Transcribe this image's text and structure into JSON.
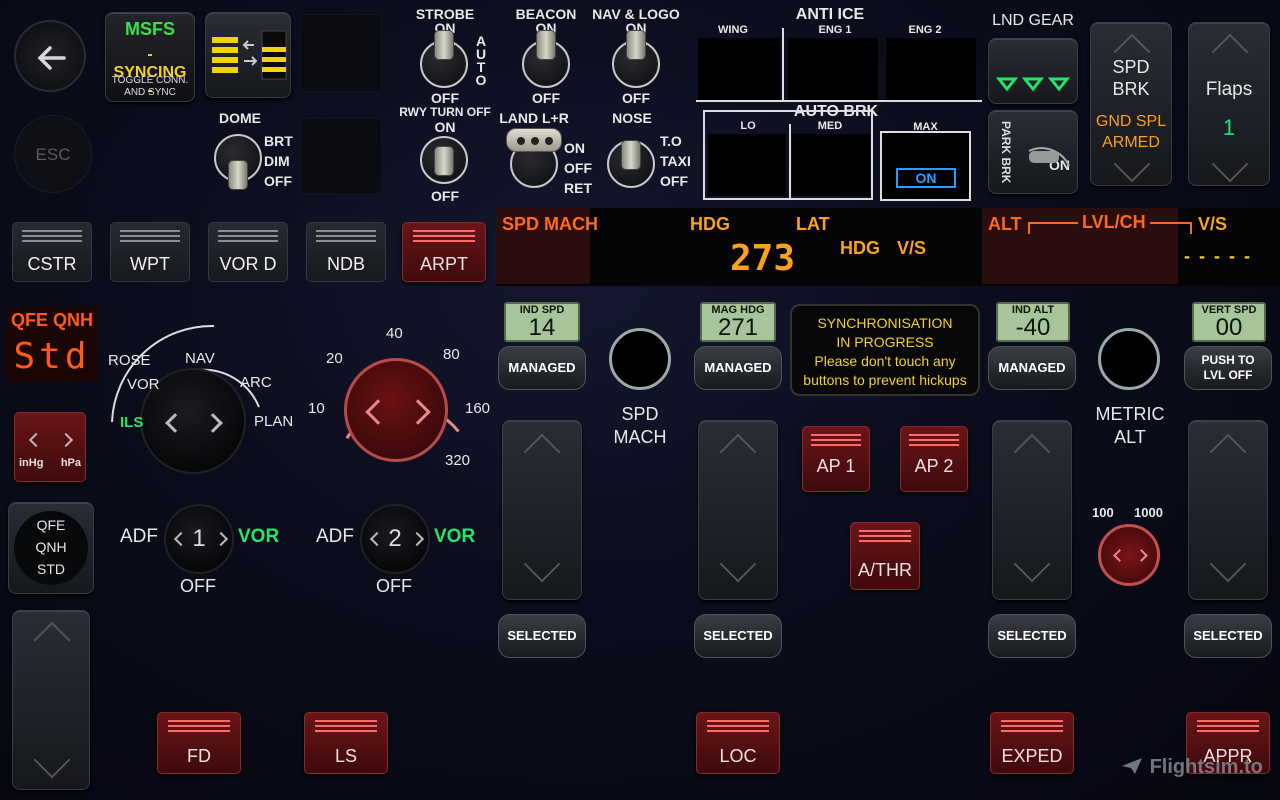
{
  "left": {
    "back_icon": "arrow-left-icon",
    "esc": "ESC",
    "msfs_title": "MSFS",
    "msfs_status": "- SYNCING -",
    "msfs_sub1": "TOGGLE CONN.",
    "msfs_sub2": "AND SYNC",
    "dome_title": "DOME",
    "dome_positions": [
      "BRT",
      "DIM",
      "OFF"
    ]
  },
  "lights": {
    "strobe": {
      "title": "STROBE",
      "top": "ON",
      "bottom": "OFF",
      "side": "AUTO"
    },
    "beacon": {
      "title": "BEACON",
      "top": "ON",
      "bottom": "OFF"
    },
    "navlogo": {
      "title": "NAV & LOGO",
      "top": "ON",
      "bottom": "OFF"
    },
    "rwy": {
      "title": "RWY TURN OFF",
      "top": "ON",
      "bottom": "OFF"
    },
    "land": {
      "title": "LAND L+R",
      "pos": [
        "ON",
        "OFF",
        "RET"
      ]
    },
    "nose": {
      "title": "NOSE",
      "pos": [
        "T.O",
        "TAXI",
        "OFF"
      ]
    }
  },
  "anti_ice": {
    "title": "ANTI ICE",
    "cols": [
      "WING",
      "ENG 1",
      "ENG 2"
    ]
  },
  "auto_brk": {
    "title": "AUTO BRK",
    "cols": [
      "LO",
      "MED",
      "MAX"
    ],
    "max_state": "ON"
  },
  "gear": {
    "title": "LND GEAR",
    "park_brk": "PARK BRK",
    "park_state": "ON"
  },
  "spd_brk": {
    "title1": "SPD",
    "title2": "BRK",
    "state1": "GND SPL",
    "state2": "ARMED"
  },
  "flaps": {
    "title": "Flaps",
    "value": "1"
  },
  "efis": {
    "keys": [
      "CSTR",
      "WPT",
      "VOR D",
      "NDB",
      "ARPT"
    ]
  },
  "fma": {
    "spd_mach": "SPD MACH",
    "hdg": "HDG",
    "lat": "LAT",
    "hdg_val": "273",
    "hdg2": "HDG",
    "vs": "V/S",
    "alt": "ALT",
    "lvlch": "LVL/CH",
    "vs2": "V/S",
    "vs_dashes": "- - - - -"
  },
  "baro": {
    "title": "QFE QNH",
    "value": "Std",
    "unit_l": "inHg",
    "unit_r": "hPa",
    "mode1": "QFE",
    "mode2": "QNH",
    "mode3": "STD"
  },
  "nd_mode": {
    "labels": [
      "ROSE",
      "NAV",
      "VOR",
      "ARC",
      "ILS",
      "PLAN"
    ]
  },
  "nd_range": {
    "labels": [
      "10",
      "20",
      "40",
      "80",
      "160",
      "320"
    ]
  },
  "adf": {
    "one": {
      "left": "ADF",
      "num": "1",
      "right": "VOR",
      "off": "OFF"
    },
    "two": {
      "left": "ADF",
      "num": "2",
      "right": "VOR",
      "off": "OFF"
    }
  },
  "fcu": {
    "spd": {
      "title": "IND SPD",
      "value": "14",
      "managed": "MANAGED",
      "selected": "SELECTED"
    },
    "spd_mach": [
      "SPD",
      "MACH"
    ],
    "hdg": {
      "title": "MAG HDG",
      "value": "271",
      "managed": "MANAGED",
      "selected": "SELECTED"
    },
    "sync": [
      "SYNCHRONISATION",
      "IN PROGRESS",
      "Please don't touch any",
      "buttons to prevent hickups"
    ],
    "alt": {
      "title": "IND ALT",
      "value": "-40",
      "managed": "MANAGED",
      "selected": "SELECTED"
    },
    "metric": [
      "METRIC",
      "ALT"
    ],
    "alt_scale": [
      "100",
      "1000"
    ],
    "vs": {
      "title": "VERT SPD",
      "value": "00",
      "push1": "PUSH TO",
      "push2": "LVL OFF",
      "selected": "SELECTED"
    },
    "ap1": "AP 1",
    "ap2": "AP 2",
    "athr": "A/THR"
  },
  "bottom": {
    "fd": "FD",
    "ls": "LS",
    "loc": "LOC",
    "exped": "EXPED",
    "appr": "APPR"
  },
  "watermark": "Flightsim.to"
}
